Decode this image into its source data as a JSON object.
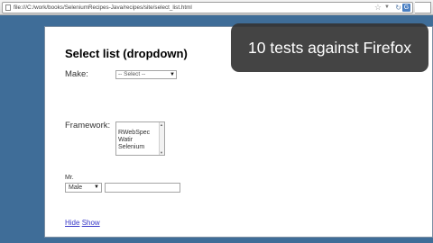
{
  "browser": {
    "url": "file:///C:/work/books/SeleniumRecipes-Java/recipes/site/select_list.html",
    "search_engine_letter": "G"
  },
  "page": {
    "title": "Select list (dropdown)",
    "make_label": "Make:",
    "make_selected": "-- Select --",
    "framework_label": "Framework:",
    "framework_options": [
      "RWebSpec",
      "Watir",
      "Selenium"
    ],
    "title_label": "Mr.",
    "gender_selected": "Male",
    "name_value": "",
    "link_hide": "Hide",
    "link_show": "Show"
  },
  "overlay": {
    "caption": "10 tests against Firefox"
  },
  "colors": {
    "desktop_bg": "#3f6d98",
    "link": "#3737c8",
    "caption_bg": "#343434"
  }
}
